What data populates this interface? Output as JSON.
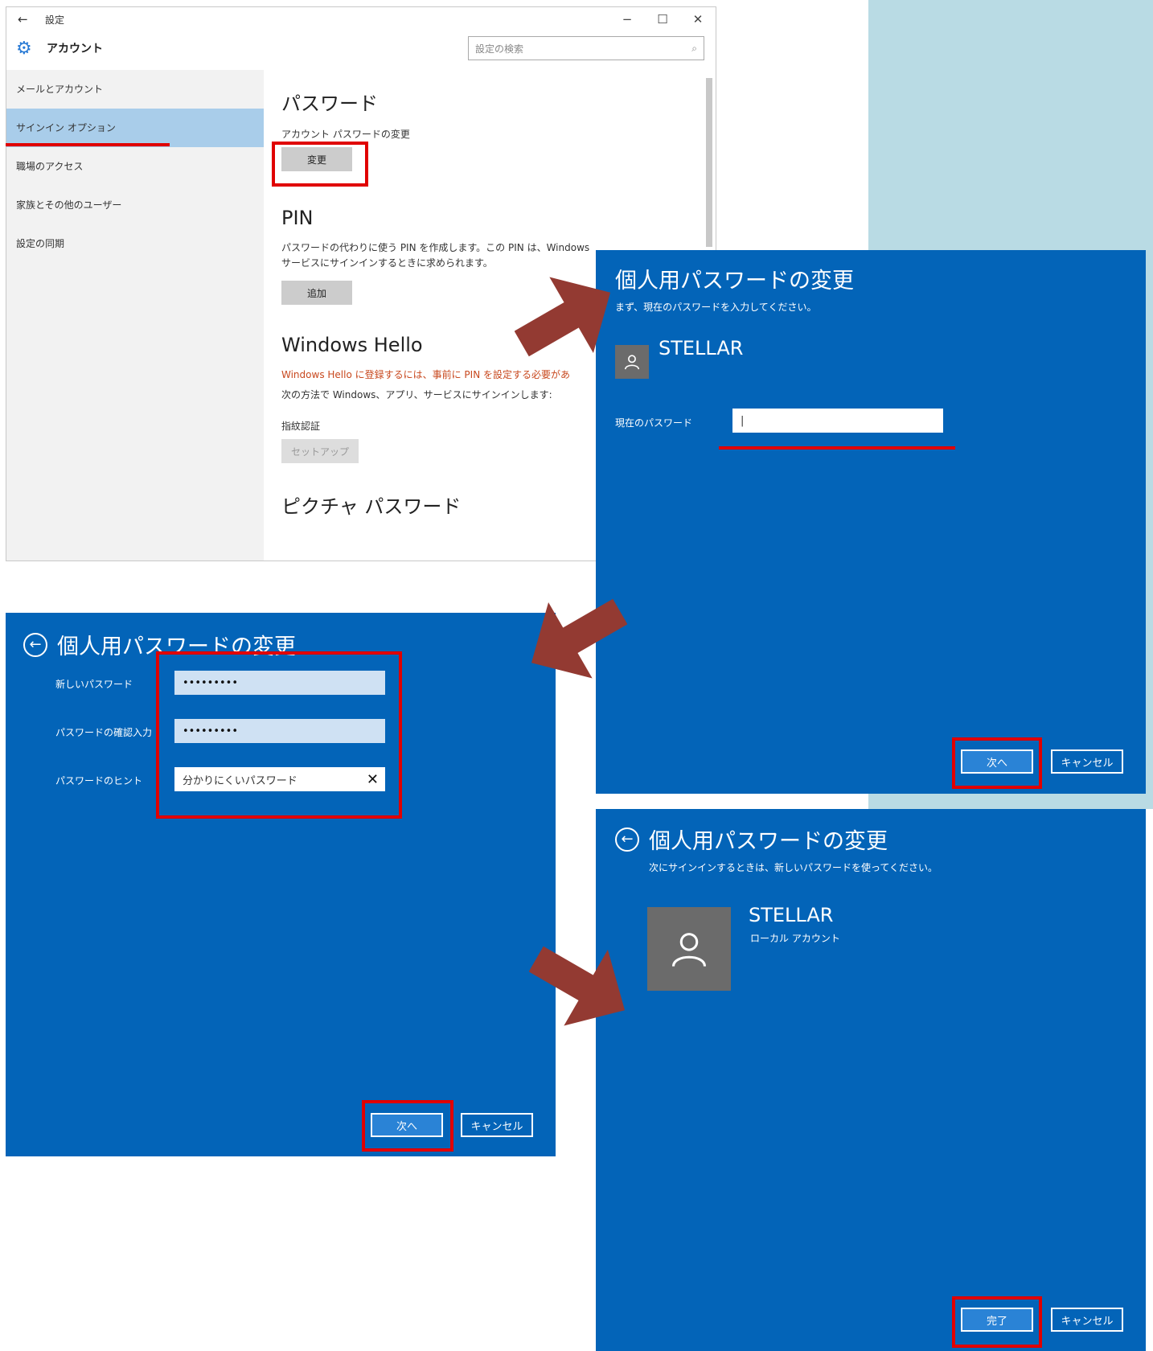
{
  "settings": {
    "titlebar": {
      "back_icon": "←",
      "title": "設定",
      "minimize": "−",
      "maximize": "☐",
      "close": "✕"
    },
    "header": {
      "app_title": "アカウント",
      "search_placeholder": "設定の検索",
      "search_icon": "⌕"
    },
    "sidebar": {
      "items": [
        {
          "label": "メールとアカウント"
        },
        {
          "label": "サインイン オプション"
        },
        {
          "label": "職場のアクセス"
        },
        {
          "label": "家族とその他のユーザー"
        },
        {
          "label": "設定の同期"
        }
      ]
    },
    "password": {
      "heading": "パスワード",
      "desc": "アカウント パスワードの変更",
      "button": "変更"
    },
    "pin": {
      "heading": "PIN",
      "desc1": "パスワードの代わりに使う PIN を作成します。この PIN は、Windows",
      "desc2": "サービスにサインインするときに求められます。",
      "button": "追加"
    },
    "hello": {
      "heading": "Windows Hello",
      "warning": "Windows Hello に登録するには、事前に PIN を設定する必要があ",
      "desc": "次の方法で Windows、アプリ、サービスにサインインします:",
      "fingerprint_label": "指紋認証",
      "button": "セットアップ"
    },
    "picture": {
      "heading": "ピクチャ パスワード"
    }
  },
  "dialog1": {
    "title": "個人用パスワードの変更",
    "subtitle": "まず、現在のパスワードを入力してください。",
    "username": "STELLAR",
    "current_password_label": "現在のパスワード",
    "current_password_value": "|",
    "next_button": "次へ",
    "cancel_button": "キャンセル"
  },
  "dialog2": {
    "title": "個人用パスワードの変更",
    "new_password_label": "新しいパスワード",
    "new_password_value": "•••••••••",
    "confirm_label": "パスワードの確認入力",
    "confirm_value": "•••••••••",
    "hint_label": "パスワードのヒント",
    "hint_value": "分かりにくいパスワード",
    "clear_icon": "✕",
    "next_button": "次へ",
    "cancel_button": "キャンセル"
  },
  "dialog3": {
    "title": "個人用パスワードの変更",
    "subtitle": "次にサインインするときは、新しいパスワードを使ってください。",
    "username": "STELLAR",
    "account_type": "ローカル アカウント",
    "finish_button": "完了",
    "cancel_button": "キャンセル"
  },
  "colors": {
    "dialog_blue": "#0364b8",
    "annotation_red": "#e00000",
    "arrow": "#933a32",
    "background_band": "#b9dbe4",
    "sidebar_selected": "#a9cdea"
  }
}
